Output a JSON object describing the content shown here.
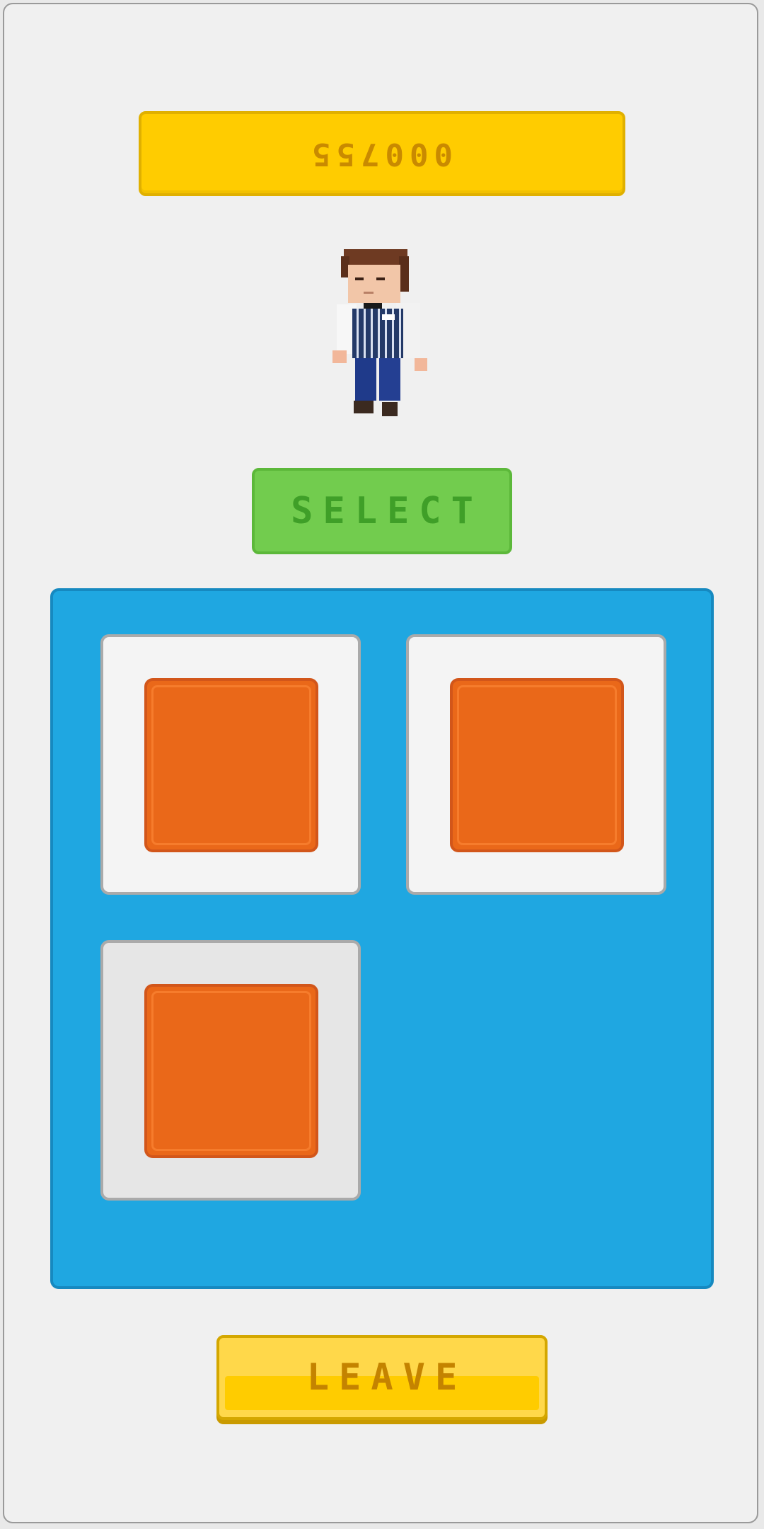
{
  "hud": {
    "score": "000755"
  },
  "character": {
    "name": "waiter-character"
  },
  "buttons": {
    "select_label": "SELECT",
    "leave_label": "LEAVE"
  },
  "grid": {
    "slots": [
      {
        "item": "orange-tile",
        "selected": false
      },
      {
        "item": "orange-tile",
        "selected": false
      },
      {
        "item": "orange-tile",
        "selected": true
      }
    ]
  },
  "colors": {
    "background": "#f0f0f0",
    "score_bar": "#ffcc00",
    "select_button": "#72cc4e",
    "panel": "#1fa7e1",
    "tile": "#ea6819",
    "leave_button": "#ffd84a"
  }
}
